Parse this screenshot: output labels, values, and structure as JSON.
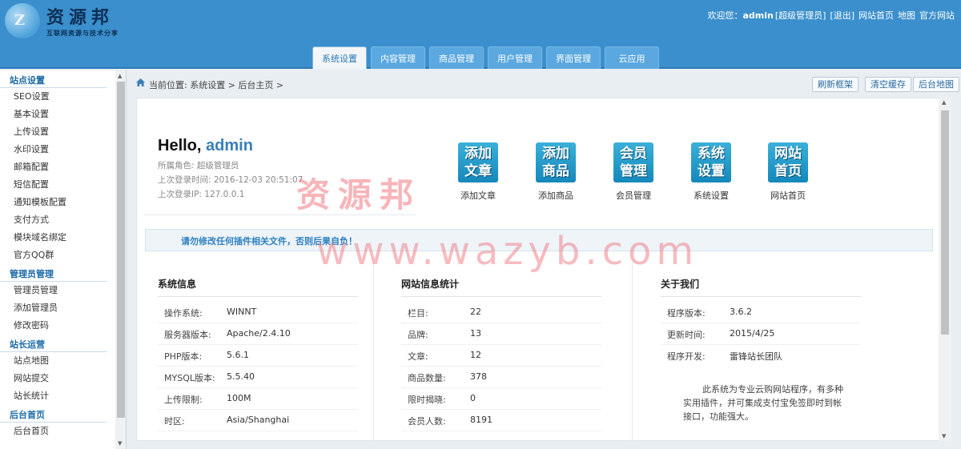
{
  "brand": {
    "logo_glyph": "Z",
    "title": "资源邦",
    "subtitle": "互联网资源与技术分享"
  },
  "top_links": {
    "welcome": "欢迎您：",
    "user": "admin",
    "role": "[超级管理员]",
    "logout": "[退出]",
    "site_home": "网站首页",
    "map": "地图",
    "official": "官方网站"
  },
  "tabs": [
    {
      "label": "系统设置",
      "active": true
    },
    {
      "label": "内容管理",
      "active": false
    },
    {
      "label": "商品管理",
      "active": false
    },
    {
      "label": "用户管理",
      "active": false
    },
    {
      "label": "界面管理",
      "active": false
    },
    {
      "label": "云应用",
      "active": false
    }
  ],
  "sidebar": {
    "groups": [
      {
        "title": "站点设置",
        "items": [
          "SEO设置",
          "基本设置",
          "上传设置",
          "水印设置",
          "邮箱配置",
          "短信配置",
          "通知模板配置",
          "支付方式",
          "模块域名绑定",
          "官方QQ群"
        ]
      },
      {
        "title": "管理员管理",
        "items": [
          "管理员管理",
          "添加管理员",
          "修改密码"
        ]
      },
      {
        "title": "站长运营",
        "items": [
          "站点地图",
          "网站提交",
          "站长统计"
        ]
      },
      {
        "title": "后台首页",
        "items": [
          "后台首页"
        ]
      }
    ]
  },
  "crumb": "当前位置: 系统设置 > 后台主页 >",
  "toolbar": {
    "refresh": "刷新框架",
    "clear_cache": "清空缓存",
    "admin_map": "后台地图"
  },
  "hello": {
    "greeting": "Hello,",
    "user": "admin",
    "role": "所属角色: 超级管理员",
    "last_time": "上次登录时间: 2016-12-03 20:51:07",
    "last_ip": "上次登录IP: 127.0.0.1"
  },
  "quick_links": [
    {
      "icon_text": [
        "添加",
        "文章"
      ],
      "label": "添加文章"
    },
    {
      "icon_text": [
        "添加",
        "商品"
      ],
      "label": "添加商品"
    },
    {
      "icon_text": [
        "会员",
        "管理"
      ],
      "label": "会员管理"
    },
    {
      "icon_text": [
        "系统",
        "设置"
      ],
      "label": "系统设置"
    },
    {
      "icon_text": [
        "网站",
        "首页"
      ],
      "label": "网站首页"
    }
  ],
  "notice": "请勿修改任何插件相关文件，否则后果自负！",
  "system_info": {
    "title": "系统信息",
    "rows": [
      {
        "k": "操作系统:",
        "v": "WINNT"
      },
      {
        "k": "服务器版本:",
        "v": "Apache/2.4.10"
      },
      {
        "k": "PHP版本:",
        "v": "5.6.1"
      },
      {
        "k": "MYSQL版本:",
        "v": "5.5.40"
      },
      {
        "k": "上传限制:",
        "v": "100M"
      },
      {
        "k": "时区:",
        "v": "Asia/Shanghai"
      }
    ]
  },
  "site_stats": {
    "title": "网站信息统计",
    "rows": [
      {
        "k": "栏目:",
        "v": "22"
      },
      {
        "k": "品牌:",
        "v": "13"
      },
      {
        "k": "文章:",
        "v": "12"
      },
      {
        "k": "商品数量:",
        "v": "378"
      },
      {
        "k": "限时揭晓:",
        "v": "0"
      },
      {
        "k": "会员人数:",
        "v": "8191"
      }
    ]
  },
  "about": {
    "title": "关于我们",
    "rows": [
      {
        "k": "程序版本:",
        "v": "3.6.2"
      },
      {
        "k": "更新时间:",
        "v": "2015/4/25"
      },
      {
        "k": "程序开发:",
        "v": "雷锋站长团队"
      }
    ],
    "text": "此系统为专业云购网站程序，有多种实用插件，并可集成支付宝免签即时到帐接口，功能强大。"
  },
  "watermark": {
    "cn": "资源邦",
    "url": "www.wazyb.com"
  }
}
